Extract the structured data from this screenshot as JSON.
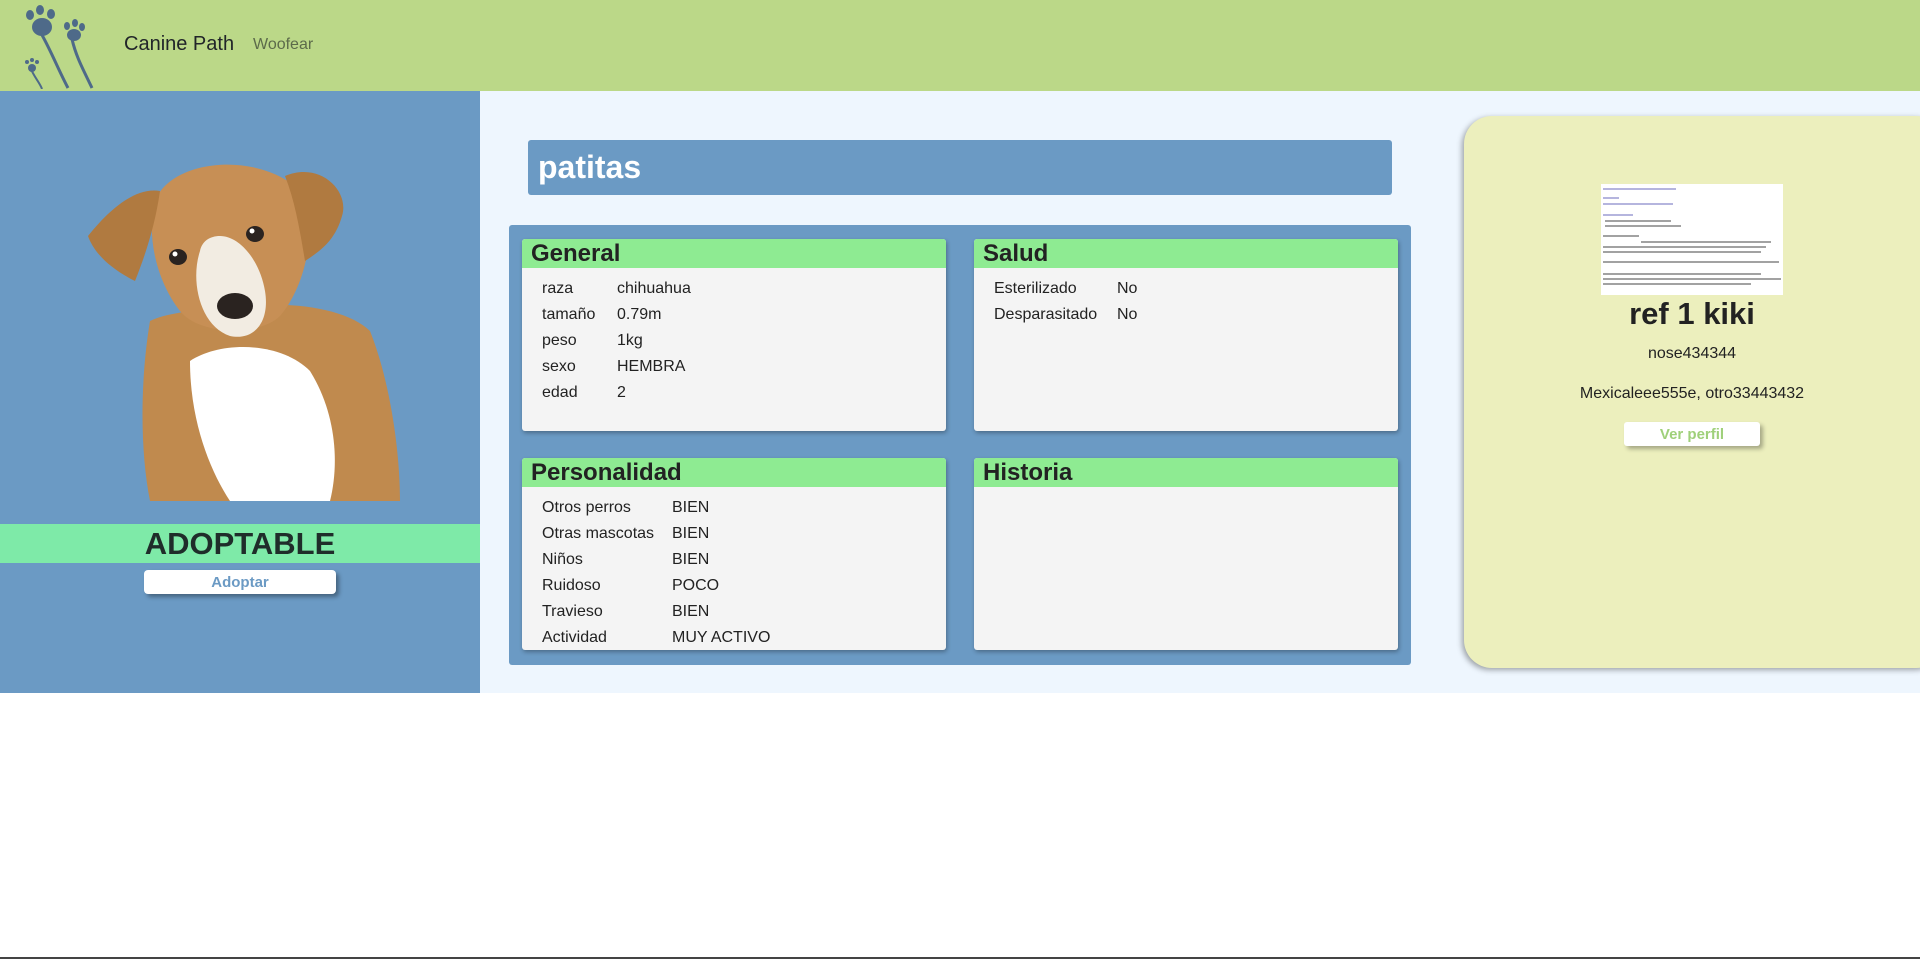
{
  "navbar": {
    "brand": "Canine Path",
    "link": "Woofear",
    "logo_icon": "paw-prints-logo-icon",
    "color": "#bbd888"
  },
  "pet": {
    "name": "patitas",
    "status": "ADOPTABLE",
    "adopt_label": "Adoptar",
    "photo_icon": "puppy-photo"
  },
  "general": {
    "title": "General",
    "rows": [
      {
        "k": "raza",
        "v": "chihuahua"
      },
      {
        "k": "tamaño",
        "v": "0.79m"
      },
      {
        "k": "peso",
        "v": "1kg"
      },
      {
        "k": "sexo",
        "v": "HEMBRA"
      },
      {
        "k": "edad",
        "v": "2"
      }
    ]
  },
  "salud": {
    "title": "Salud",
    "rows": [
      {
        "k": "Esterilizado",
        "v": "No"
      },
      {
        "k": "Desparasitado",
        "v": "No"
      }
    ]
  },
  "personalidad": {
    "title": "Personalidad",
    "rows": [
      {
        "k": "Otros perros",
        "v": "BIEN"
      },
      {
        "k": "Otras mascotas",
        "v": "BIEN"
      },
      {
        "k": "Niños",
        "v": "BIEN"
      },
      {
        "k": "Ruidoso",
        "v": "POCO"
      },
      {
        "k": "Travieso",
        "v": "BIEN"
      },
      {
        "k": "Actividad",
        "v": "MUY ACTIVO"
      }
    ]
  },
  "historia": {
    "title": "Historia"
  },
  "ref": {
    "title": "ref 1 kiki",
    "id": "nose434344",
    "extra": "Mexicaleee555e, otro33443432",
    "button": "Ver perfil",
    "thumb_icon": "code-output-thumbnail"
  },
  "colors": {
    "accent_blue": "#6b9ac4",
    "card_header_green": "#8eeb92",
    "status_green": "#7eeaa8",
    "ref_card_bg": "#ecefbd"
  }
}
